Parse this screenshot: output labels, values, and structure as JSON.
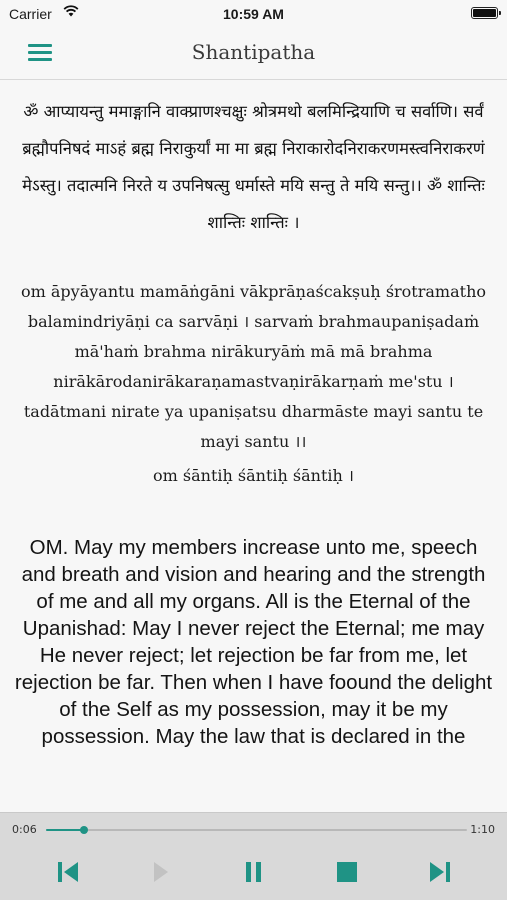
{
  "status_bar": {
    "carrier": "Carrier",
    "time": "10:59 AM"
  },
  "nav": {
    "title": "Shantipatha",
    "menu_icon": "hamburger-menu-icon"
  },
  "content": {
    "sanskrit": "ॐ आप्यायन्तु ममाङ्गानि वाक्प्राणश्चक्षुः श्रोत्रमथो बलमिन्द्रियाणि च सर्वाणि। सर्वं ब्रह्मौपनिषदं माऽहं ब्रह्म निराकुर्यां मा मा ब्रह्म निराकारोदनिराकरणमस्त्वनिराकरणं मेऽस्तु। तदात्मनि निरते य उपनिषत्सु धर्मास्ते मयि सन्तु ते मयि सन्तु।। ॐ शान्तिः शान्तिः शान्तिः ।",
    "transliteration": "om āpyāyantu mamāṅgāni vākprāṇaścakṣuḥ śrotramatho balamindriyāṇi ca sarvāṇi । sarvaṁ brahmaupaniṣadaṁ mā'haṁ brahma nirākuryāṁ mā mā brahma nirākārodanirākaraṇamastvaṇirākarṇaṁ me'stu । tadātmani nirate ya upaniṣatsu dharmāste mayi santu te mayi santu ।।",
    "transliteration_shanti": "om śāntiḥ śāntiḥ śāntiḥ ।",
    "english": "OM. May my members increase unto me, speech and breath and vision and hearing and the strength of me and all my organs. All is the Eternal of the Upanishad: May I never reject the Eternal; me may He never reject; let rejection be far from me, let rejection be far. Then when I have foound the delight of the Self as my possession, may it be my possession. May the law that is declared in the"
  },
  "player": {
    "elapsed": "0:06",
    "total": "1:10",
    "progress_fraction": 0.09,
    "accent_color": "#1f9385",
    "disabled_color": "#c2c2c2",
    "controls": [
      "previous-track-icon",
      "play-icon",
      "pause-icon",
      "stop-icon",
      "next-track-icon"
    ]
  }
}
